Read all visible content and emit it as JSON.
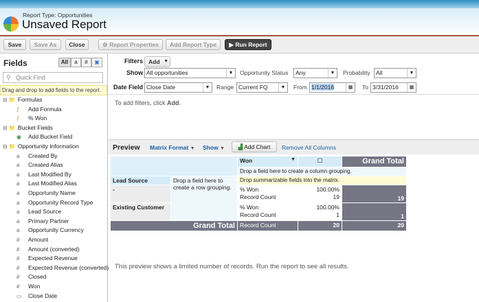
{
  "header": {
    "report_type": "Report Type: Opportunities",
    "title": "Unsaved Report"
  },
  "toolbar": {
    "save": "Save",
    "save_as": "Save As",
    "close": "Close",
    "report_properties": "Report Properties",
    "add_report_type": "Add Report Type",
    "run_report": "Run Report"
  },
  "fields": {
    "title": "Fields",
    "filter_all": "All",
    "filter_text": "a",
    "filter_num": "#",
    "quick_find_placeholder": "Quick Find",
    "hint": "Drag and drop to add fields to the report.",
    "tree": [
      {
        "label": "Formulas",
        "type": "folder",
        "level": 0
      },
      {
        "label": "Add Formula",
        "type": "formula",
        "level": 1
      },
      {
        "label": "% Won",
        "type": "formula",
        "level": 1
      },
      {
        "label": "Bucket Fields",
        "type": "folder",
        "level": 0
      },
      {
        "label": "Add Bucket Field",
        "type": "bucket",
        "level": 1
      },
      {
        "label": "Opportunity Information",
        "type": "folder",
        "level": 0
      },
      {
        "label": "Created By",
        "type": "text",
        "level": 1
      },
      {
        "label": "Created Alias",
        "type": "text",
        "level": 1
      },
      {
        "label": "Last Modified By",
        "type": "text",
        "level": 1
      },
      {
        "label": "Last Modified Alias",
        "type": "text",
        "level": 1
      },
      {
        "label": "Opportunity Name",
        "type": "text",
        "level": 1
      },
      {
        "label": "Opportunity Record Type",
        "type": "text",
        "level": 1
      },
      {
        "label": "Lead Source",
        "type": "text",
        "level": 1
      },
      {
        "label": "Primary Partner",
        "type": "text",
        "level": 1
      },
      {
        "label": "Opportunity Currency",
        "type": "text",
        "level": 1
      },
      {
        "label": "Amount",
        "type": "number",
        "level": 1
      },
      {
        "label": "Amount (converted)",
        "type": "number",
        "level": 1
      },
      {
        "label": "Expected Revenue",
        "type": "number",
        "level": 1
      },
      {
        "label": "Expected Revenue (converted)",
        "type": "number",
        "level": 1
      },
      {
        "label": "Closed",
        "type": "number",
        "level": 1
      },
      {
        "label": "Won",
        "type": "number",
        "level": 1
      },
      {
        "label": "Close Date",
        "type": "date",
        "level": 1
      }
    ]
  },
  "filters": {
    "label": "Filters",
    "add": "Add",
    "show_label": "Show",
    "show_value": "All opportunities",
    "status_label": "Opportunity Status",
    "status_value": "Any",
    "prob_label": "Probability",
    "prob_value": "All",
    "date_field_label": "Date Field",
    "date_field_value": "Close Date",
    "range_label": "Range",
    "range_value": "Current FQ",
    "from_label": "From",
    "from_value": "1/1/2016",
    "to_label": "To",
    "to_value": "3/31/2016",
    "hint_pre": "To add filters, click ",
    "hint_bold": "Add",
    "hint_post": "."
  },
  "preview": {
    "title": "Preview",
    "format": "Matrix Format",
    "show": "Show",
    "add_chart": "Add Chart",
    "remove_cols": "Remove All Columns",
    "col_group": "Won",
    "col_drop": "Drop a field here to create a column grouping.",
    "grand_total": "Grand Total",
    "row_group": "Lead Source",
    "row_drop": "Drop a field here to create a row grouping.",
    "summ_drop": "Drop summarizable fields into the matrix.",
    "rows": [
      {
        "label": "-",
        "m1": "% Won",
        "m2": "Record Count",
        "v1": "100.00%",
        "v2": "19",
        "total": "19"
      },
      {
        "label": "Existing Customer",
        "m1": "% Won",
        "m2": "Record Count",
        "v1": "100.00%",
        "v2": "1",
        "total": "1"
      }
    ],
    "gt_metric": "Record Count",
    "gt_value": "20",
    "gt_total": "20",
    "message": "This preview shows a limited number of records. Run the report to see all results."
  }
}
